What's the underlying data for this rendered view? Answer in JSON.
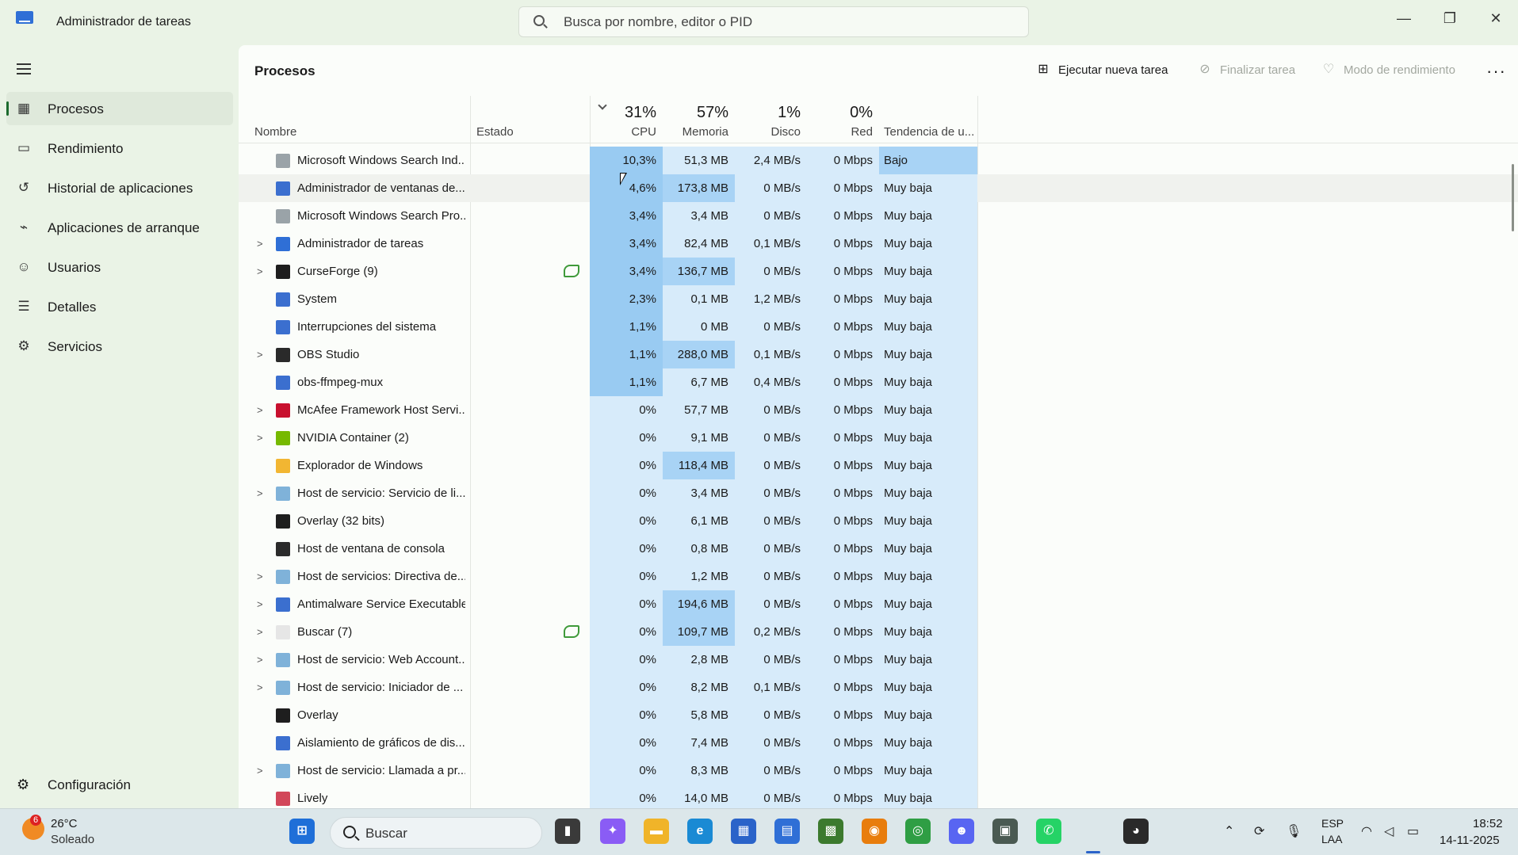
{
  "app": {
    "title": "Administrador de tareas"
  },
  "search": {
    "placeholder": "Busca por nombre, editor o PID"
  },
  "window_controls": {
    "minimize": "—",
    "maximize": "❐",
    "close": "✕"
  },
  "sidebar": {
    "items": [
      {
        "label": "Procesos",
        "icon": "processes-icon",
        "glyph": "▦",
        "active": true
      },
      {
        "label": "Rendimiento",
        "icon": "performance-icon",
        "glyph": "▭",
        "active": false
      },
      {
        "label": "Historial de aplicaciones",
        "icon": "history-icon",
        "glyph": "↺",
        "active": false
      },
      {
        "label": "Aplicaciones de arranque",
        "icon": "startup-icon",
        "glyph": "⌁",
        "active": false
      },
      {
        "label": "Usuarios",
        "icon": "users-icon",
        "glyph": "☺",
        "active": false
      },
      {
        "label": "Detalles",
        "icon": "details-icon",
        "glyph": "☰",
        "active": false
      },
      {
        "label": "Servicios",
        "icon": "services-icon",
        "glyph": "⚙",
        "active": false
      }
    ],
    "settings_label": "Configuración"
  },
  "page": {
    "title": "Procesos"
  },
  "toolbar": {
    "run_task": "Ejecutar nueva tarea",
    "end_task": "Finalizar tarea",
    "efficiency": "Modo de rendimiento",
    "more": "···"
  },
  "columns": {
    "name": "Nombre",
    "status": "Estado",
    "cpu": {
      "label": "CPU",
      "pct": "31%"
    },
    "memory": {
      "label": "Memoria",
      "pct": "57%"
    },
    "disk": {
      "label": "Disco",
      "pct": "1%"
    },
    "network": {
      "label": "Red",
      "pct": "0%"
    },
    "power": "Tendencia de u..."
  },
  "processes": [
    {
      "name": "Microsoft Windows Search Ind...",
      "expandable": false,
      "eco": false,
      "icon": "search-service-icon",
      "iconColor": "#9aa3a8",
      "cpu": "10,3%",
      "mem": "51,3 MB",
      "disk": "2,4 MB/s",
      "net": "0 Mbps",
      "power": "Bajo",
      "cpuLevel": 3,
      "memLevel": 1,
      "powerLevel": 2
    },
    {
      "name": "Administrador de ventanas de...",
      "expandable": false,
      "eco": false,
      "icon": "window-icon",
      "iconColor": "#3b6fcf",
      "cpu": "4,6%",
      "mem": "173,8 MB",
      "disk": "0 MB/s",
      "net": "0 Mbps",
      "power": "Muy baja",
      "cpuLevel": 3,
      "memLevel": 2,
      "powerLevel": 1
    },
    {
      "name": "Microsoft Windows Search Pro...",
      "expandable": false,
      "eco": false,
      "icon": "search-service-icon",
      "iconColor": "#9aa3a8",
      "cpu": "3,4%",
      "mem": "3,4 MB",
      "disk": "0 MB/s",
      "net": "0 Mbps",
      "power": "Muy baja",
      "cpuLevel": 3,
      "memLevel": 1,
      "powerLevel": 1
    },
    {
      "name": "Administrador de tareas",
      "expandable": true,
      "eco": false,
      "icon": "task-manager-icon",
      "iconColor": "#2f6fd6",
      "cpu": "3,4%",
      "mem": "82,4 MB",
      "disk": "0,1 MB/s",
      "net": "0 Mbps",
      "power": "Muy baja",
      "cpuLevel": 3,
      "memLevel": 1,
      "powerLevel": 1
    },
    {
      "name": "CurseForge (9)",
      "expandable": true,
      "eco": true,
      "icon": "curseforge-icon",
      "iconColor": "#1e1e1e",
      "cpu": "3,4%",
      "mem": "136,7 MB",
      "disk": "0 MB/s",
      "net": "0 Mbps",
      "power": "Muy baja",
      "cpuLevel": 3,
      "memLevel": 2,
      "powerLevel": 1
    },
    {
      "name": "System",
      "expandable": false,
      "eco": false,
      "icon": "window-icon",
      "iconColor": "#3b6fcf",
      "cpu": "2,3%",
      "mem": "0,1 MB",
      "disk": "1,2 MB/s",
      "net": "0 Mbps",
      "power": "Muy baja",
      "cpuLevel": 3,
      "memLevel": 1,
      "powerLevel": 1
    },
    {
      "name": "Interrupciones del sistema",
      "expandable": false,
      "eco": false,
      "icon": "window-icon",
      "iconColor": "#3b6fcf",
      "cpu": "1,1%",
      "mem": "0 MB",
      "disk": "0 MB/s",
      "net": "0 Mbps",
      "power": "Muy baja",
      "cpuLevel": 3,
      "memLevel": 1,
      "powerLevel": 1
    },
    {
      "name": "OBS Studio",
      "expandable": true,
      "eco": false,
      "icon": "obs-icon",
      "iconColor": "#2a2a2a",
      "cpu": "1,1%",
      "mem": "288,0 MB",
      "disk": "0,1 MB/s",
      "net": "0 Mbps",
      "power": "Muy baja",
      "cpuLevel": 3,
      "memLevel": 2,
      "powerLevel": 1
    },
    {
      "name": "obs-ffmpeg-mux",
      "expandable": false,
      "eco": false,
      "icon": "window-icon",
      "iconColor": "#3b6fcf",
      "cpu": "1,1%",
      "mem": "6,7 MB",
      "disk": "0,4 MB/s",
      "net": "0 Mbps",
      "power": "Muy baja",
      "cpuLevel": 3,
      "memLevel": 1,
      "powerLevel": 1
    },
    {
      "name": "McAfee Framework Host Servi...",
      "expandable": true,
      "eco": false,
      "icon": "mcafee-icon",
      "iconColor": "#c8102e",
      "cpu": "0%",
      "mem": "57,7 MB",
      "disk": "0 MB/s",
      "net": "0 Mbps",
      "power": "Muy baja",
      "cpuLevel": 1,
      "memLevel": 1,
      "powerLevel": 1
    },
    {
      "name": "NVIDIA Container (2)",
      "expandable": true,
      "eco": false,
      "icon": "nvidia-icon",
      "iconColor": "#76b900",
      "cpu": "0%",
      "mem": "9,1 MB",
      "disk": "0 MB/s",
      "net": "0 Mbps",
      "power": "Muy baja",
      "cpuLevel": 1,
      "memLevel": 1,
      "powerLevel": 1
    },
    {
      "name": "Explorador de Windows",
      "expandable": false,
      "eco": false,
      "icon": "folder-icon",
      "iconColor": "#f2b632",
      "cpu": "0%",
      "mem": "118,4 MB",
      "disk": "0 MB/s",
      "net": "0 Mbps",
      "power": "Muy baja",
      "cpuLevel": 1,
      "memLevel": 2,
      "powerLevel": 1
    },
    {
      "name": "Host de servicio: Servicio de li...",
      "expandable": true,
      "eco": false,
      "icon": "service-gear-icon",
      "iconColor": "#7fb2d9",
      "cpu": "0%",
      "mem": "3,4 MB",
      "disk": "0 MB/s",
      "net": "0 Mbps",
      "power": "Muy baja",
      "cpuLevel": 1,
      "memLevel": 1,
      "powerLevel": 1
    },
    {
      "name": "Overlay (32 bits)",
      "expandable": false,
      "eco": false,
      "icon": "overlay-icon",
      "iconColor": "#1e1e1e",
      "cpu": "0%",
      "mem": "6,1 MB",
      "disk": "0 MB/s",
      "net": "0 Mbps",
      "power": "Muy baja",
      "cpuLevel": 1,
      "memLevel": 1,
      "powerLevel": 1
    },
    {
      "name": "Host de ventana de consola",
      "expandable": false,
      "eco": false,
      "icon": "console-icon",
      "iconColor": "#2b2b2b",
      "cpu": "0%",
      "mem": "0,8 MB",
      "disk": "0 MB/s",
      "net": "0 Mbps",
      "power": "Muy baja",
      "cpuLevel": 1,
      "memLevel": 1,
      "powerLevel": 1
    },
    {
      "name": "Host de servicios: Directiva de...",
      "expandable": true,
      "eco": false,
      "icon": "service-gear-icon",
      "iconColor": "#7fb2d9",
      "cpu": "0%",
      "mem": "1,2 MB",
      "disk": "0 MB/s",
      "net": "0 Mbps",
      "power": "Muy baja",
      "cpuLevel": 1,
      "memLevel": 1,
      "powerLevel": 1
    },
    {
      "name": "Antimalware Service Executable",
      "expandable": true,
      "eco": false,
      "icon": "window-icon",
      "iconColor": "#3b6fcf",
      "cpu": "0%",
      "mem": "194,6 MB",
      "disk": "0 MB/s",
      "net": "0 Mbps",
      "power": "Muy baja",
      "cpuLevel": 1,
      "memLevel": 2,
      "powerLevel": 1
    },
    {
      "name": "Buscar (7)",
      "expandable": true,
      "eco": true,
      "icon": "search-app-icon",
      "iconColor": "#e6e6e6",
      "cpu": "0%",
      "mem": "109,7 MB",
      "disk": "0,2 MB/s",
      "net": "0 Mbps",
      "power": "Muy baja",
      "cpuLevel": 1,
      "memLevel": 2,
      "powerLevel": 1
    },
    {
      "name": "Host de servicio: Web Account...",
      "expandable": true,
      "eco": false,
      "icon": "service-gear-icon",
      "iconColor": "#7fb2d9",
      "cpu": "0%",
      "mem": "2,8 MB",
      "disk": "0 MB/s",
      "net": "0 Mbps",
      "power": "Muy baja",
      "cpuLevel": 1,
      "memLevel": 1,
      "powerLevel": 1
    },
    {
      "name": "Host de servicio: Iniciador de ...",
      "expandable": true,
      "eco": false,
      "icon": "service-gear-icon",
      "iconColor": "#7fb2d9",
      "cpu": "0%",
      "mem": "8,2 MB",
      "disk": "0,1 MB/s",
      "net": "0 Mbps",
      "power": "Muy baja",
      "cpuLevel": 1,
      "memLevel": 1,
      "powerLevel": 1
    },
    {
      "name": "Overlay",
      "expandable": false,
      "eco": false,
      "icon": "overlay-icon",
      "iconColor": "#1e1e1e",
      "cpu": "0%",
      "mem": "5,8 MB",
      "disk": "0 MB/s",
      "net": "0 Mbps",
      "power": "Muy baja",
      "cpuLevel": 1,
      "memLevel": 1,
      "powerLevel": 1
    },
    {
      "name": "Aislamiento de gráficos de dis...",
      "expandable": false,
      "eco": false,
      "icon": "window-icon",
      "iconColor": "#3b6fcf",
      "cpu": "0%",
      "mem": "7,4 MB",
      "disk": "0 MB/s",
      "net": "0 Mbps",
      "power": "Muy baja",
      "cpuLevel": 1,
      "memLevel": 1,
      "powerLevel": 1
    },
    {
      "name": "Host de servicio: Llamada a pr...",
      "expandable": true,
      "eco": false,
      "icon": "service-gear-icon",
      "iconColor": "#7fb2d9",
      "cpu": "0%",
      "mem": "8,3 MB",
      "disk": "0 MB/s",
      "net": "0 Mbps",
      "power": "Muy baja",
      "cpuLevel": 1,
      "memLevel": 1,
      "powerLevel": 1
    },
    {
      "name": "Lively",
      "expandable": false,
      "eco": false,
      "icon": "lively-icon",
      "iconColor": "#d2475a",
      "cpu": "0%",
      "mem": "14,0 MB",
      "disk": "0 MB/s",
      "net": "0 Mbps",
      "power": "Muy baja",
      "cpuLevel": 1,
      "memLevel": 1,
      "powerLevel": 1
    }
  ],
  "heat_colors": {
    "level1": "#d7ebfa",
    "level2": "#a8d3f5",
    "level3": "#99cbf2"
  },
  "taskbar": {
    "weather": {
      "badge": "6",
      "temp": "26°C",
      "desc": "Soleado"
    },
    "search_label": "Buscar",
    "apps": [
      {
        "name": "start-button",
        "glyph": "⊞",
        "color": "#1f6fd8"
      },
      {
        "name": "files-app-icon",
        "glyph": "▮",
        "color": "#3a3a3a"
      },
      {
        "name": "copilot-icon",
        "glyph": "✦",
        "color": "#8a5cf5"
      },
      {
        "name": "file-explorer-icon",
        "glyph": "▬",
        "color": "#f0b429"
      },
      {
        "name": "edge-icon",
        "glyph": "e",
        "color": "#1a8ad4"
      },
      {
        "name": "store-icon",
        "glyph": "▦",
        "color": "#2a63c9"
      },
      {
        "name": "task-manager-taskbar-icon",
        "glyph": "▤",
        "color": "#2f6fd6"
      },
      {
        "name": "minecraft-icon",
        "glyph": "▩",
        "color": "#3c7a2e"
      },
      {
        "name": "blender-icon",
        "glyph": "◉",
        "color": "#e87d0d"
      },
      {
        "name": "chrome-icon",
        "glyph": "◎",
        "color": "#2f9e44"
      },
      {
        "name": "discord-icon",
        "glyph": "☻",
        "color": "#5865f2"
      },
      {
        "name": "game-icon",
        "glyph": "▣",
        "color": "#4a5a52"
      },
      {
        "name": "whatsapp-icon",
        "glyph": "✆",
        "color": "#25d366"
      },
      {
        "name": "task-manager-taskbar-icon-2",
        "glyph": "▤",
        "color": "#2f6fd6"
      },
      {
        "name": "obs-taskbar-icon",
        "glyph": "◕",
        "color": "#2a2a2a"
      }
    ],
    "lang_top": "ESP",
    "lang_bottom": "LAA",
    "time": "18:52",
    "date": "14-11-2025"
  }
}
